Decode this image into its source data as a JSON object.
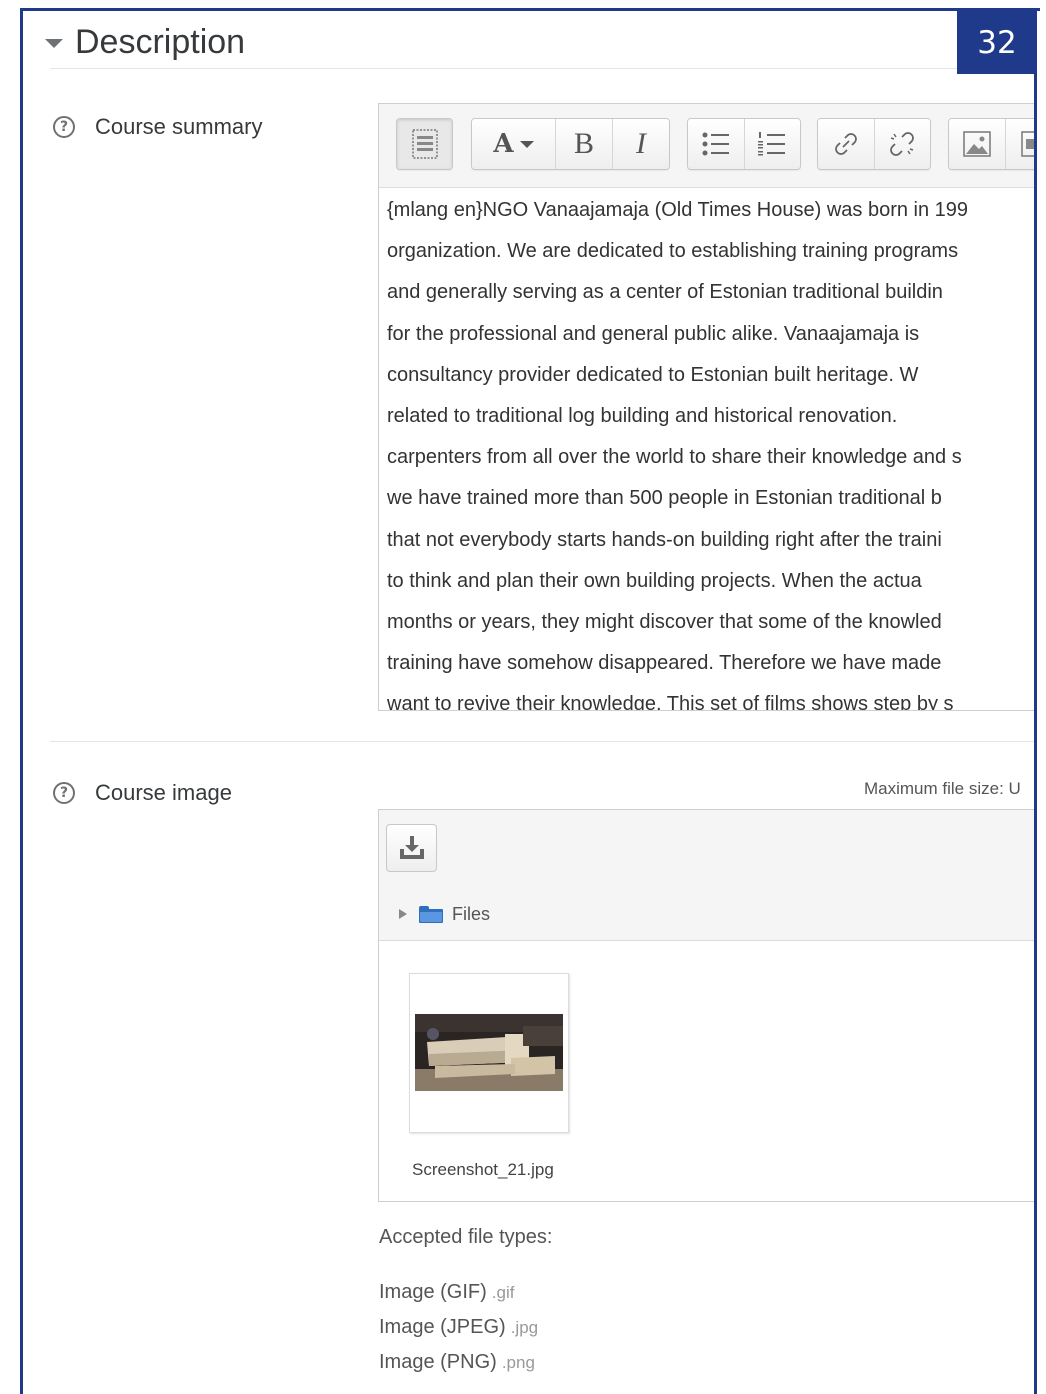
{
  "page_number": "32",
  "section": {
    "title": "Description"
  },
  "course_summary": {
    "label": "Course summary",
    "help_icon": "question-circle-icon",
    "toolbar": {
      "buttons": [
        "toolbar-toggle-icon",
        "font-style-icon",
        "bold-icon",
        "italic-icon",
        "bullet-list-icon",
        "numbered-list-icon",
        "link-icon",
        "unlink-icon",
        "image-icon",
        "media-icon"
      ],
      "font_style_label": "A",
      "bold_label": "B",
      "italic_label": "I"
    },
    "text_lines": [
      "{mlang en}NGO Vanaajamaja (Old Times House) was born in 199",
      "organization. We are dedicated to establishing training programs",
      "and generally serving as a center of Estonian traditional buildin",
      "for the professional and general public alike. Vanaajamaja is",
      "consultancy provider dedicated to Estonian built heritage. W",
      "related to traditional log building and historical renovation.",
      "carpenters from all over the world to share their knowledge and s",
      "we have trained more than 500 people in Estonian traditional b",
      "that not everybody starts hands-on building right after the traini",
      "to think and plan their own building projects. When the actua",
      "months or years, they might discover that some of the knowled",
      "training have somehow disappeared. Therefore we have made",
      "want to revive their knowledge. This set of films shows step by s"
    ]
  },
  "course_image": {
    "label": "Course image",
    "help_icon": "question-circle-icon",
    "max_file_size": "Maximum file size: U",
    "add_file_icon": "download-tray-icon",
    "path_label": "Files",
    "file": {
      "name": "Screenshot_21.jpg"
    },
    "accepted_title": "Accepted file types:",
    "accepted_types": [
      {
        "name": "Image (GIF)",
        "ext": ".gif"
      },
      {
        "name": "Image (JPEG)",
        "ext": ".jpg"
      },
      {
        "name": "Image (PNG)",
        "ext": ".png"
      }
    ]
  }
}
